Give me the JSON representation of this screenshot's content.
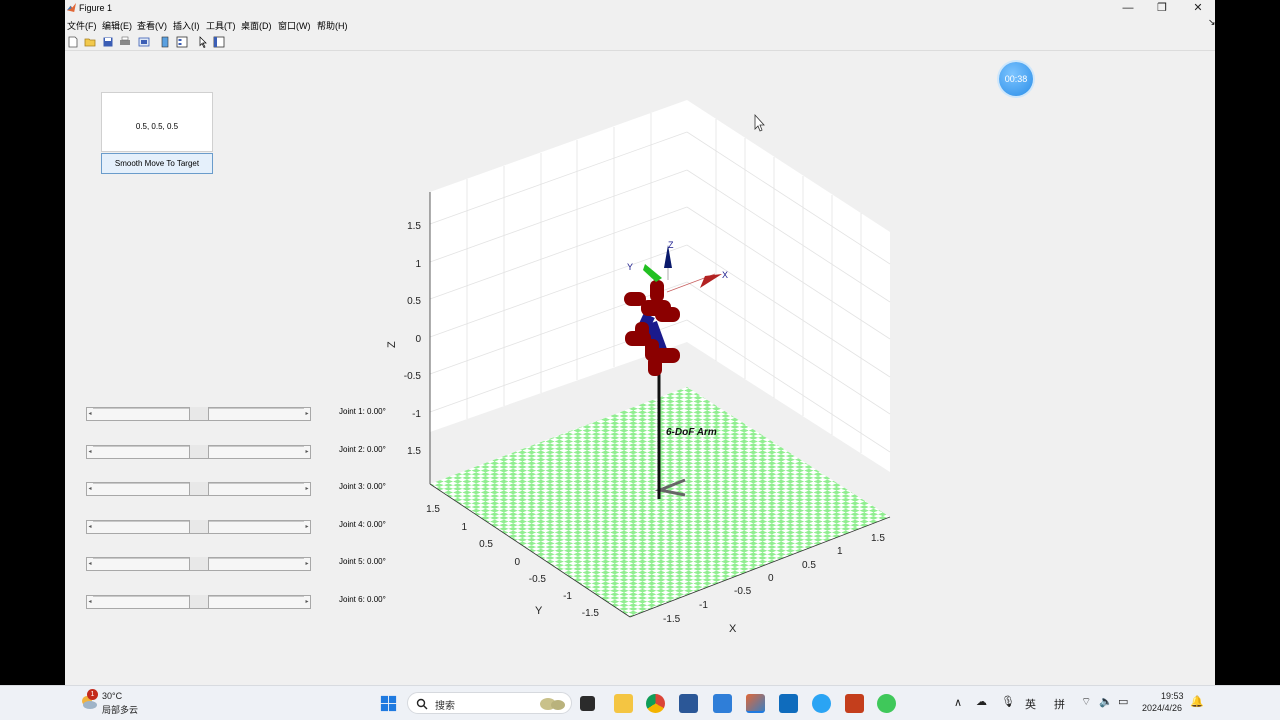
{
  "window": {
    "title": "Figure 1",
    "minimize": "—",
    "restore": "❐",
    "close": "✕"
  },
  "menu": [
    "文件(F)",
    "编辑(E)",
    "查看(V)",
    "插入(I)",
    "工具(T)",
    "桌面(D)",
    "窗口(W)",
    "帮助(H)"
  ],
  "toolbar_icons": [
    "new-figure-icon",
    "open-file-icon",
    "save-icon",
    "print-icon",
    "link-plot-icon",
    "insert-colorbar-icon",
    "insert-legend-icon",
    "pointer-icon",
    "property-editor-icon"
  ],
  "controls": {
    "target_value": "0.5, 0.5, 0.5",
    "move_button": "Smooth Move To Target",
    "joints": [
      {
        "label": "Joint 1: 0.00°",
        "value": 0.5
      },
      {
        "label": "Joint 2: 0.00°",
        "value": 0.5
      },
      {
        "label": "Joint 3: 0.00°",
        "value": 0.5
      },
      {
        "label": "Joint 4: 0.00°",
        "value": 0.5
      },
      {
        "label": "Joint 5: 0.00°",
        "value": 0.5
      },
      {
        "label": "Joint 6: 0.00°",
        "value": 0.5
      }
    ]
  },
  "timer": "00:38",
  "plot": {
    "title": "6-DoF Arm",
    "xlabel": "X",
    "ylabel": "Y",
    "zlabel": "Z",
    "z_ticks": [
      "1.5",
      "1",
      "0.5",
      "0",
      "-0.5",
      "-1",
      "1.5"
    ],
    "y_ticks": [
      "1.5",
      "1",
      "0.5",
      "0",
      "-0.5",
      "-1",
      "-1.5"
    ],
    "x_ticks": [
      "-1.5",
      "-1",
      "-0.5",
      "0",
      "0.5",
      "1",
      "1.5"
    ],
    "frame_axes": {
      "x": "X",
      "y": "Y",
      "z": "Z"
    },
    "floor_colors": [
      "#90ee90",
      "#ffffff"
    ],
    "link_color": "#8b0000",
    "joint_color": "#1a1a8c"
  },
  "taskbar": {
    "weather_temp": "30°C",
    "weather_desc": "局部多云",
    "weather_badge": "1",
    "search_placeholder": "搜索",
    "ime_lang": "英",
    "ime_mode": "拼",
    "time": "19:53",
    "date": "2024/4/26"
  }
}
